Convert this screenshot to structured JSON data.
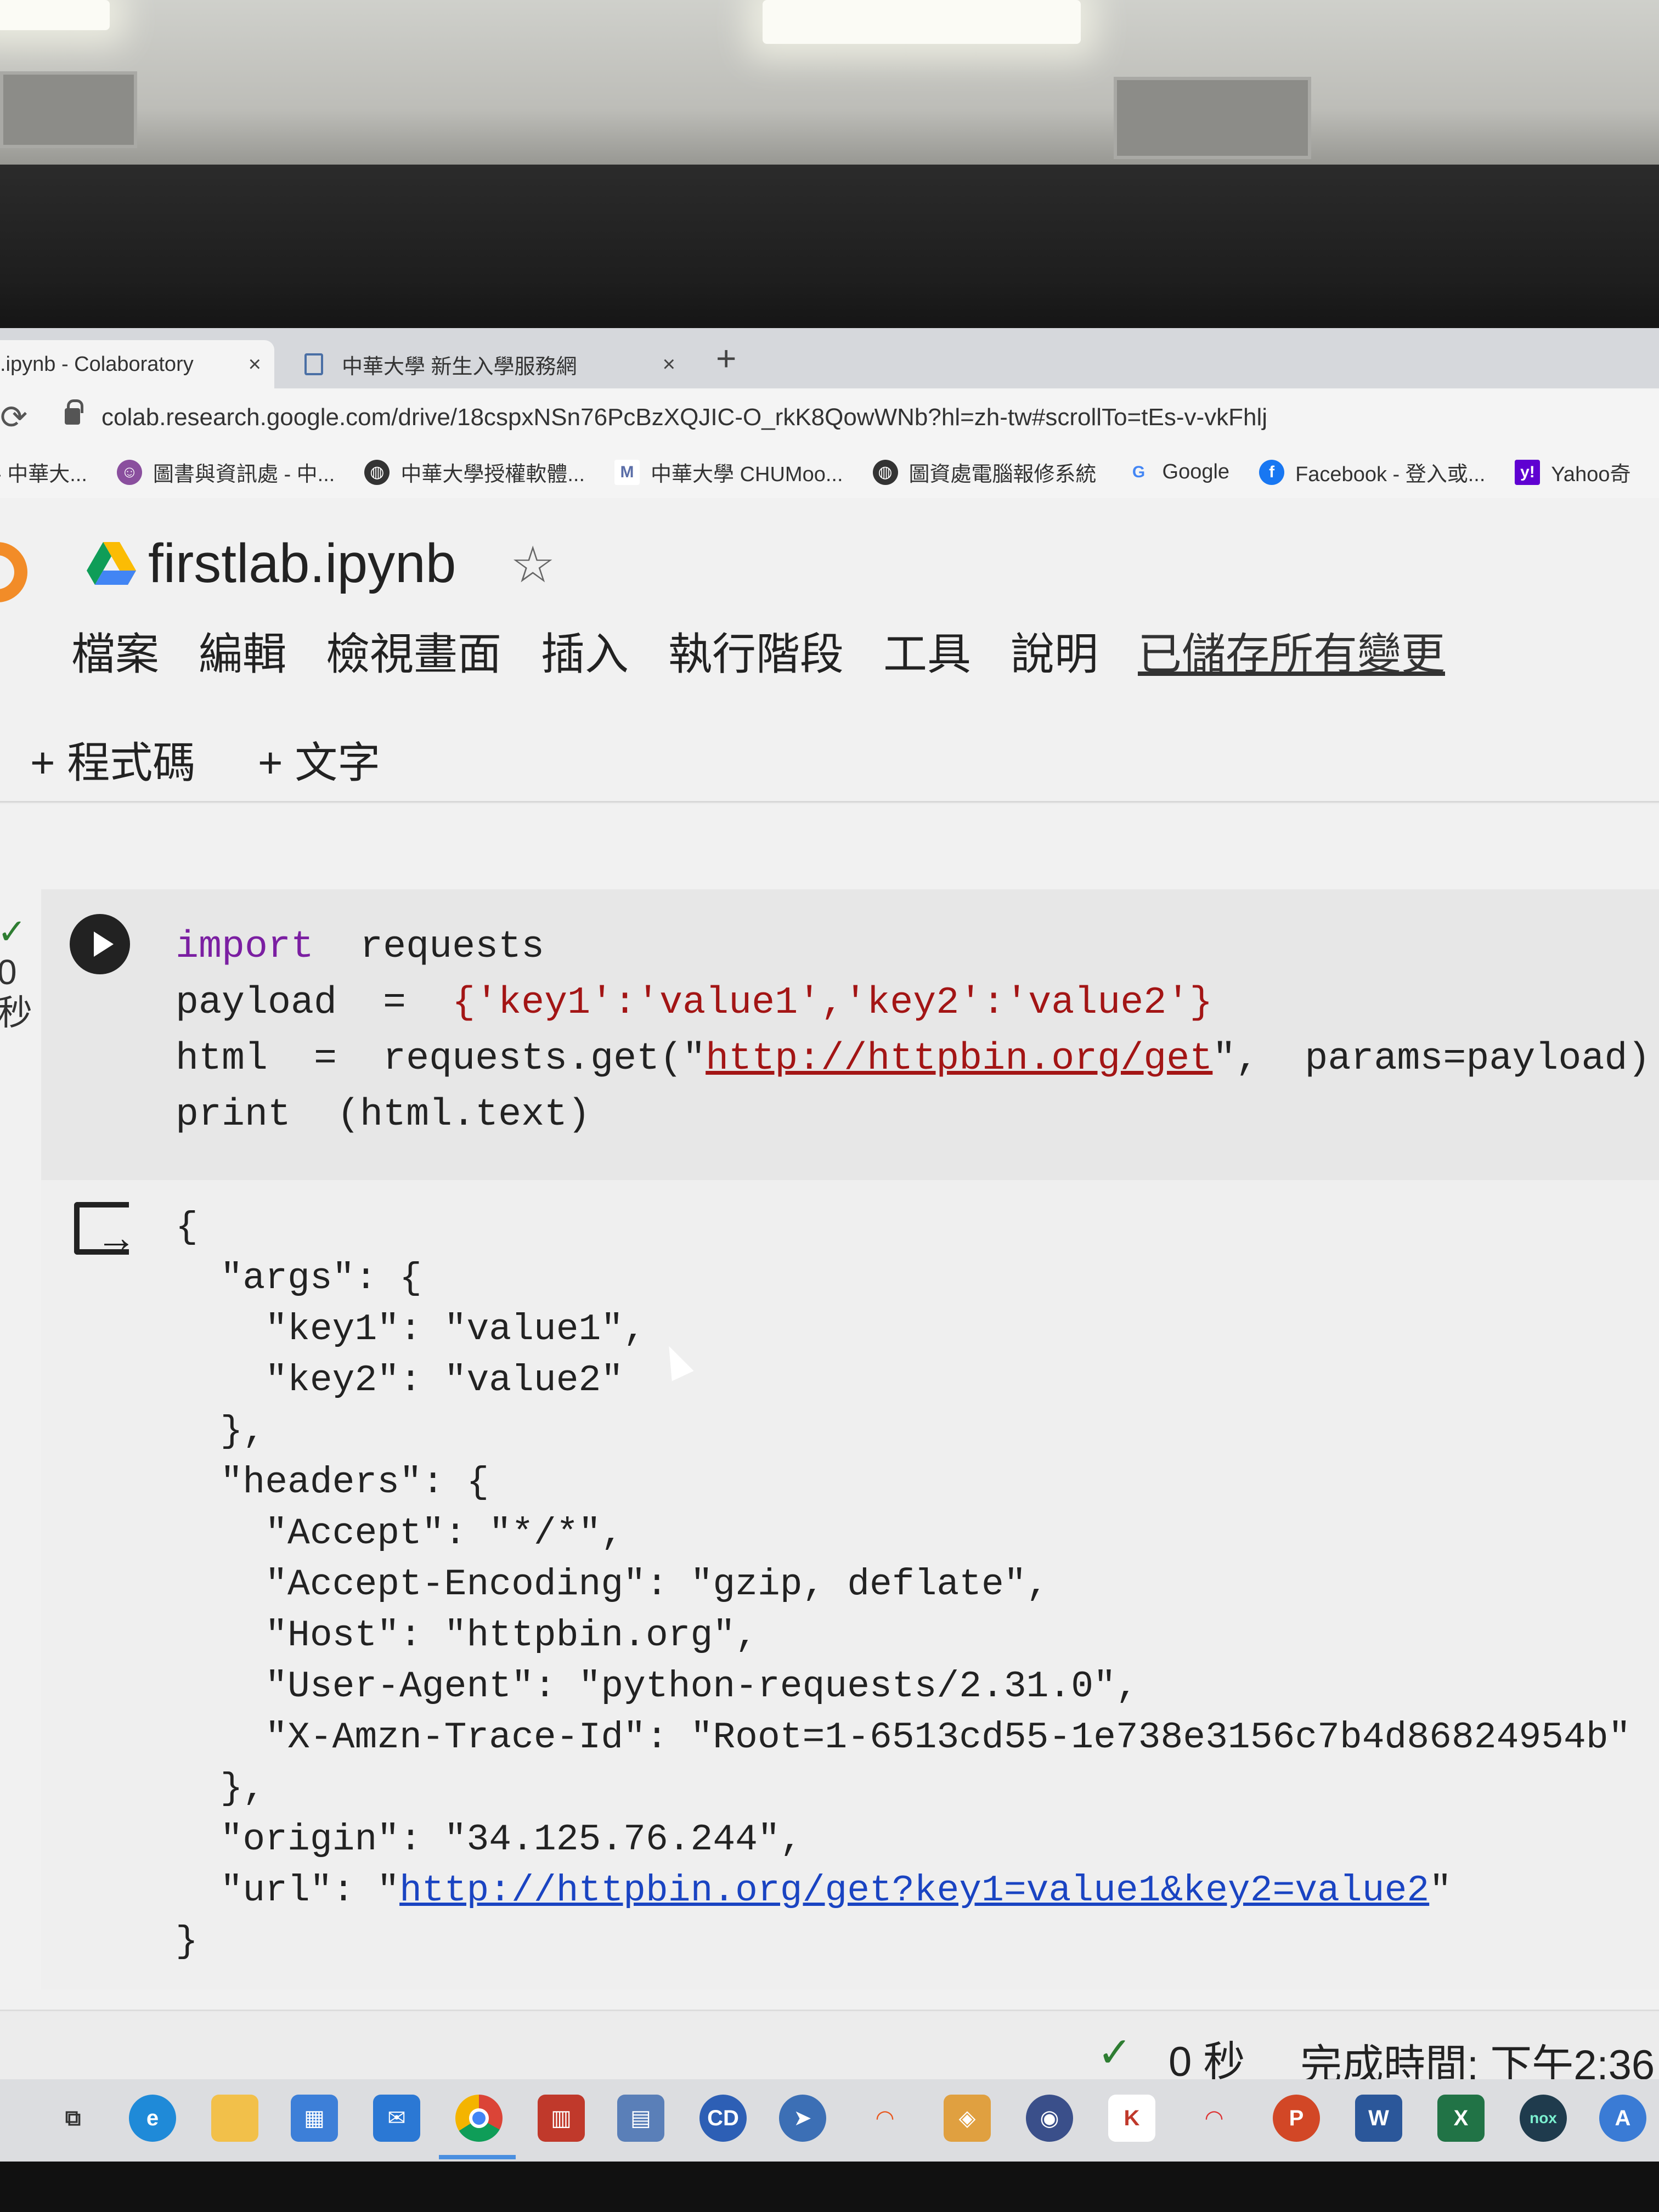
{
  "tabs": [
    {
      "label": ".ipynb - Colaboratory",
      "close": "×"
    },
    {
      "label": "中華大學 新生入學服務網",
      "close": "×"
    }
  ],
  "new_tab": "+",
  "address": {
    "url": "colab.research.google.com/drive/18cspxNSn76PcBzXQJIC-O_rkK8QowWNb?hl=zh-tw#scrollTo=tEs-v-vkFhlj"
  },
  "bookmarks": [
    {
      "label": "- 中華大...",
      "icon": "bookmark-icon"
    },
    {
      "label": "圖書與資訊處 - 中...",
      "icon": "library-icon"
    },
    {
      "label": "中華大學授權軟體...",
      "icon": "globe-icon"
    },
    {
      "label": "中華大學 CHUMoo...",
      "icon": "m-icon"
    },
    {
      "label": "圖資處電腦報修系統",
      "icon": "globe-icon"
    },
    {
      "label": "Google",
      "icon": "google-icon"
    },
    {
      "label": "Facebook - 登入或...",
      "icon": "facebook-icon"
    },
    {
      "label": "Yahoo奇",
      "icon": "yahoo-icon"
    }
  ],
  "notebook": {
    "title": "firstlab.ipynb",
    "menu": [
      "檔案",
      "編輯",
      "檢視畫面",
      "插入",
      "執行階段",
      "工具",
      "說明"
    ],
    "saved_status": "已儲存所有變更",
    "add_code": "+ 程式碼",
    "add_text": "+ 文字",
    "cell_status_lines": [
      "0",
      "秒"
    ],
    "code_lines": {
      "l1_kw": "import",
      "l1_rest": "  requests",
      "l2_a": "payload  =  ",
      "l2_b": "{'key1':'value1','key2':'value2'}",
      "l3_a": "html  =  requests.get(\"",
      "l3_link": "http://httpbin.org/get",
      "l3_b": "\",  params=payload)",
      "l4": "print  (html.text)"
    },
    "output_text": "{\n  \"args\": {\n    \"key1\": \"value1\",\n    \"key2\": \"value2\"\n  },\n  \"headers\": {\n    \"Accept\": \"*/*\",\n    \"Accept-Encoding\": \"gzip, deflate\",\n    \"Host\": \"httpbin.org\",\n    \"User-Agent\": \"python-requests/2.31.0\",\n    \"X-Amzn-Trace-Id\": \"Root=1-6513cd55-1e738e3156c7b4d86824954b\"\n  },\n  \"origin\": \"34.125.76.244\",\n  \"url\": \"",
    "output_link": "http://httpbin.org/get?key1=value1&key2=value2",
    "output_tail": "\"\n}"
  },
  "statusbar": {
    "check": "✓",
    "seconds": "0 秒",
    "done": "完成時間: 下午2:36"
  },
  "taskbar_icons": [
    "task-view-icon",
    "edge-icon",
    "file-explorer-icon",
    "store-icon",
    "mail-icon",
    "chrome-icon",
    "app-icon",
    "file-icon",
    "cd-icon",
    "app-icon",
    "app-icon",
    "app-icon",
    "app-icon",
    "app-icon",
    "app-icon",
    "powerpoint-icon",
    "word-icon",
    "excel-icon",
    "nox-icon",
    "app-icon"
  ],
  "colors": {
    "accent_check": "#2e7d32",
    "code_keyword": "#7b1fa2",
    "code_string": "#a31515",
    "output_link": "#1a44c2"
  }
}
